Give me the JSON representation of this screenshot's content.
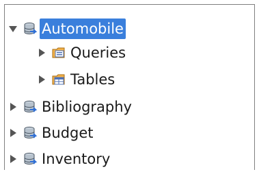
{
  "tree": {
    "automobile": {
      "label": "Automobile",
      "expanded": true,
      "selected": true,
      "icon": "database-icon"
    },
    "queries": {
      "label": "Queries",
      "icon": "queries-folder-icon"
    },
    "tables": {
      "label": "Tables",
      "icon": "tables-folder-icon"
    },
    "bibliography": {
      "label": "Bibliography",
      "icon": "database-icon"
    },
    "budget": {
      "label": "Budget",
      "icon": "database-icon"
    },
    "inventory": {
      "label": "Inventory",
      "icon": "database-icon"
    }
  },
  "colors": {
    "selection": "#3a7fdc",
    "arrow": "#555555",
    "border": "#7f7f7f"
  }
}
